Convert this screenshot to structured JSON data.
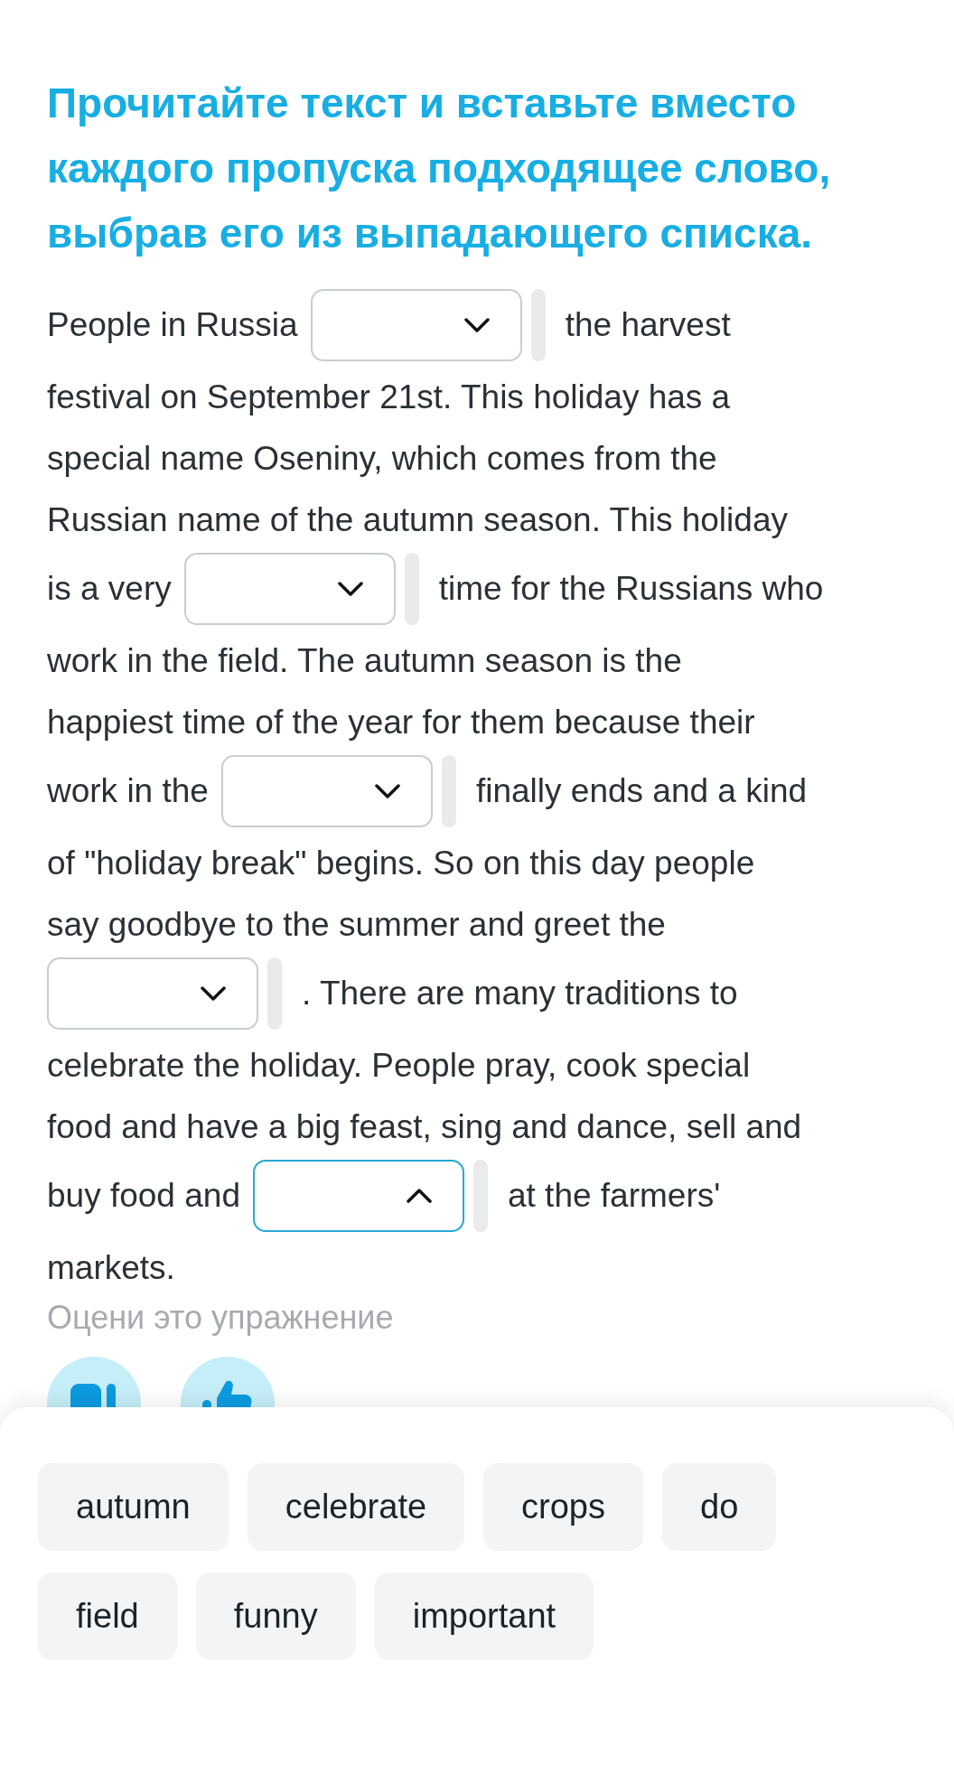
{
  "title": "Прочитайте текст и вставьте вместо каждого пропуска подходящее слово, выбрав его из выпадающего списка.",
  "passage": [
    [
      {
        "kind": "text",
        "text": "People in Russia"
      },
      {
        "kind": "blank",
        "expanded": false
      },
      {
        "kind": "text",
        "text": "the harvest"
      }
    ],
    [
      {
        "kind": "text",
        "text": "festival on September 21st. This holiday has a"
      }
    ],
    [
      {
        "kind": "text",
        "text": "special name Oseniny, which comes from the"
      }
    ],
    [
      {
        "kind": "text",
        "text": "Russian name of the autumn season. This holiday"
      }
    ],
    [
      {
        "kind": "text",
        "text": "is a very"
      },
      {
        "kind": "blank",
        "expanded": false
      },
      {
        "kind": "text",
        "text": "time for the Russians who"
      }
    ],
    [
      {
        "kind": "text",
        "text": "work in the field. The autumn season is the"
      }
    ],
    [
      {
        "kind": "text",
        "text": "happiest time of the year for them because their"
      }
    ],
    [
      {
        "kind": "text",
        "text": "work in the"
      },
      {
        "kind": "blank",
        "expanded": false
      },
      {
        "kind": "text",
        "text": "finally ends and a kind"
      }
    ],
    [
      {
        "kind": "text",
        "text": "of \"holiday break\" begins. So on this day people"
      }
    ],
    [
      {
        "kind": "text",
        "text": "say goodbye to the summer and greet the"
      }
    ],
    [
      {
        "kind": "blank",
        "expanded": false
      },
      {
        "kind": "text",
        "text": ". There are many traditions to"
      }
    ],
    [
      {
        "kind": "text",
        "text": "celebrate the holiday. People pray, cook special"
      }
    ],
    [
      {
        "kind": "text",
        "text": "food and have a big feast, sing and dance, sell and"
      }
    ],
    [
      {
        "kind": "text",
        "text": "buy food and"
      },
      {
        "kind": "blank",
        "expanded": true
      },
      {
        "kind": "text",
        "text": "at the farmers'"
      }
    ],
    [
      {
        "kind": "text",
        "text": "markets."
      }
    ]
  ],
  "rating": {
    "label": "Оцени это упражнение"
  },
  "word_bank": [
    "autumn",
    "celebrate",
    "crops",
    "do",
    "field",
    "funny",
    "important"
  ]
}
